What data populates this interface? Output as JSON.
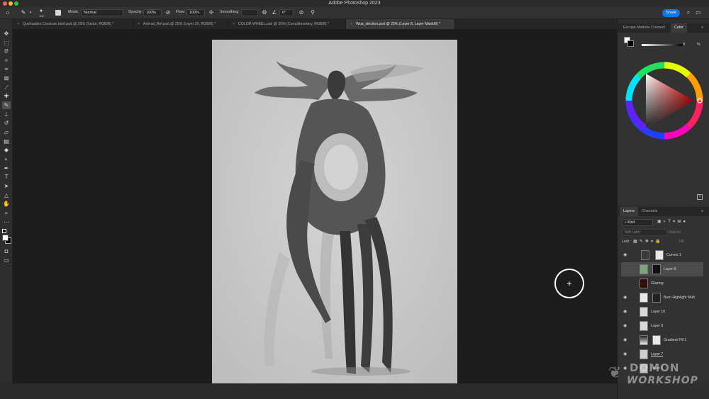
{
  "app": {
    "title": "Adobe Photoshop 2023"
  },
  "options_bar": {
    "brush_size": "100",
    "mode_label": "Mode:",
    "mode_value": "Normal",
    "opacity_label": "Opacity:",
    "opacity_value": "100%",
    "flow_label": "Flow:",
    "flow_value": "100%",
    "smoothing_label": "Smoothing:",
    "angle_value": "0°",
    "share_label": "Share"
  },
  "tabs": [
    {
      "label": "Quehualien Creature brief.psd @ 25% (Script, RGB/8) *"
    },
    {
      "label": "Animal_Ref.psd @ 25% (Layer 25, RGB/8) *"
    },
    {
      "label": "COLOR WHEEL.psd @ 25% (Complimentary, RGB/8) *"
    },
    {
      "label": "Wua_slection.psd @ 25% (Layer 8, Layer Mask/8) *"
    }
  ],
  "color_panel": {
    "tab_escape": "Escape Motions Connect",
    "tab_color": "Color",
    "slider_value": "0",
    "slider_unit": "%"
  },
  "layers_panel": {
    "tab_layers": "Layers",
    "tab_channels": "Channels",
    "kind_label": "Kind",
    "blend_value": "Soft Light",
    "opacity_label": "Opacity:",
    "lock_label": "Lock:",
    "fill_label": "Fill:",
    "layers": [
      {
        "name": "Curves 1"
      },
      {
        "name": "Layer 8"
      },
      {
        "name": "Glazing"
      },
      {
        "name": "Burn Highlight Mult"
      },
      {
        "name": "Layer 10"
      },
      {
        "name": "Layer 9"
      },
      {
        "name": "Gradient Fill 1"
      },
      {
        "name": "Layer 7"
      },
      {
        "name": "Layer 1"
      }
    ]
  },
  "watermark": {
    "line1": "DOMON",
    "line2": "WORKSHOP"
  },
  "colors": {
    "accent": "#1473e6",
    "swatch_green": "#7fa37a",
    "swatch_dark_red": "#3a0a0a"
  }
}
